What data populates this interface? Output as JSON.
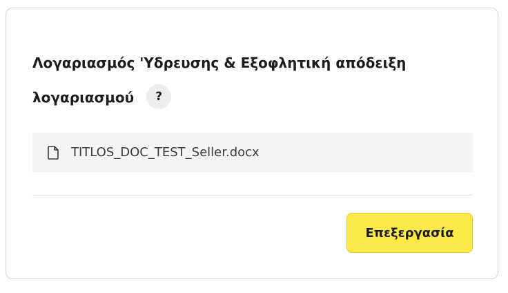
{
  "section": {
    "title_line1": "Λογαριασμός 'Υδρευσης & Εξοφλητική απόδειξη",
    "title_line2": "λογαριασμού",
    "help_symbol": "?"
  },
  "file": {
    "icon": "document-icon",
    "name": "TITLOS_DOC_TEST_Seller.docx"
  },
  "actions": {
    "edit_label": "Επεξεργασία"
  },
  "colors": {
    "button_bg": "#fbe94a",
    "file_bg": "#f3f4f6",
    "border": "#d6d6d6"
  }
}
